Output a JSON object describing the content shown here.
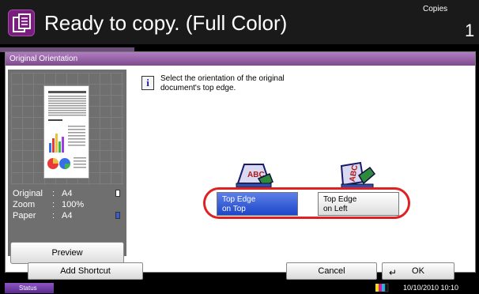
{
  "header": {
    "title": "Ready to copy. (Full Color)",
    "copies_label": "Copies",
    "copies_count": "1",
    "icon": "copy-icon"
  },
  "panel": {
    "title": "Original Orientation"
  },
  "preview": {
    "rows": [
      {
        "key": "Original",
        "value": "A4",
        "icon": "portrait-paper-icon"
      },
      {
        "key": "Zoom",
        "value": "100%"
      },
      {
        "key": "Paper",
        "value": "A4",
        "icon": "portrait-paper-icon"
      }
    ],
    "separator": ":",
    "button_label": "Preview"
  },
  "instruction": {
    "text": "Select the orientation of the original document's top edge.",
    "icon": "info-icon"
  },
  "options": [
    {
      "label_line1": "Top Edge",
      "label_line2": "on Top",
      "selected": true
    },
    {
      "label_line1": "Top Edge",
      "label_line2": "on Left",
      "selected": false
    }
  ],
  "footer": {
    "add_shortcut": "Add Shortcut",
    "cancel": "Cancel",
    "ok": "OK"
  },
  "status": {
    "label": "Status",
    "timestamp": "10/10/2010  10:10"
  },
  "colors": {
    "accent": "#7c4a8d",
    "selected": "#1d46c9",
    "highlight": "#e02121"
  }
}
